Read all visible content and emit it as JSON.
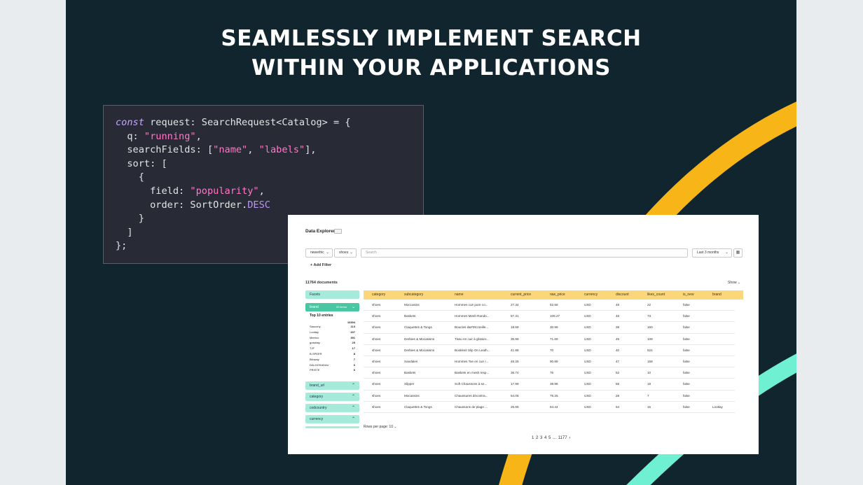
{
  "slide": {
    "headline_line1": "SEAMLESSLY IMPLEMENT SEARCH",
    "headline_line2": "WITHIN YOUR APPLICATIONS",
    "colors": {
      "background": "#10252d",
      "yellow": "#f7b518",
      "mint": "#6ff0d2",
      "page": "#e9ecef"
    }
  },
  "code": {
    "keyword_const": "const",
    "line1_rest": " request: SearchRequest<Catalog> = {",
    "q_key": "  q: ",
    "q_value": "\"running\"",
    "q_comma": ",",
    "fields_key": "  searchFields: [",
    "field1": "\"name\"",
    "fields_sep": ", ",
    "field2": "\"labels\"",
    "fields_end": "],",
    "sort_open": "  sort: [",
    "brace_open": "    {",
    "field_key": "      field: ",
    "field_value": "\"popularity\"",
    "field_comma": ",",
    "order_key": "      order: SortOrder.",
    "order_value": "DESC",
    "brace_close": "    }",
    "bracket_close": "  ]",
    "end": "};"
  },
  "explorer": {
    "title": "Data Explorer",
    "index_select": "newethic",
    "type_select": "shoes",
    "search_placeholder": "Search",
    "date_range": "Last 3 months",
    "add_filter": "+ Add Filter",
    "doc_count": "11764 documents",
    "show_label": "Show",
    "facets_label": "Facets",
    "brand_facet": {
      "label": "brand",
      "count_label": "20 items"
    },
    "top10_label": "Top 10 entries",
    "top10_total": "10394",
    "brands": [
      {
        "name": "Saucony",
        "count": "113"
      },
      {
        "name": "Lootlay",
        "count": "207"
      },
      {
        "name": "Merrico",
        "count": "391"
      },
      {
        "name": "gossbay",
        "count": "25"
      },
      {
        "name": "TJF",
        "count": "17"
      },
      {
        "name": "B-SPEER",
        "count": "8"
      },
      {
        "name": "Biloway",
        "count": "7"
      },
      {
        "name": "DALHOSADAU",
        "count": "6"
      },
      {
        "name": "PRISTE",
        "count": "6"
      }
    ],
    "other_facets": [
      "brand_url",
      "category",
      "codcountry",
      "currency"
    ],
    "columns": [
      "category",
      "subcategory",
      "name",
      "current_price",
      "raw_price",
      "currency",
      "discount",
      "likes_count",
      "is_new",
      "brand"
    ],
    "rows": [
      [
        "shoes",
        "Moccasins",
        "Hommes cuir pure co...",
        "27.34",
        "52.58",
        "USD",
        "48",
        "22",
        "false",
        ""
      ],
      [
        "shoes",
        "Baskets",
        "Hommes Mesh Rando...",
        "57.31",
        "106.27",
        "USD",
        "46",
        "73",
        "false",
        ""
      ],
      [
        "shoes",
        "Claquettes & Tongs",
        "Boucles d&#39;oreille...",
        "18.59",
        "30.99",
        "USD",
        "39",
        "160",
        "false",
        ""
      ],
      [
        "shoes",
        "Derbies & Mocassins",
        "Tissu en cuir à glissier...",
        "35.99",
        "71.69",
        "USD",
        "45",
        "108",
        "false",
        ""
      ],
      [
        "shoes",
        "Derbies & Mocassins",
        "Bookknit Slip On Leath...",
        "41.88",
        "70",
        "USD",
        "40",
        "524",
        "false",
        ""
      ],
      [
        "shoes",
        "Sandales",
        "Hommes Toe en cuir r...",
        "48.25",
        "90.89",
        "USD",
        "47",
        "158",
        "false",
        ""
      ],
      [
        "shoes",
        "Baskets",
        "Baskets en mesh resp...",
        "36.74",
        "76",
        "USD",
        "52",
        "10",
        "false",
        ""
      ],
      [
        "shoes",
        "Slipper",
        "Soft Chaussons à se...",
        "17.99",
        "39.98",
        "USD",
        "55",
        "19",
        "false",
        ""
      ],
      [
        "shoes",
        "Mocassins",
        "Chaussures décontra...",
        "54.06",
        "75.25",
        "USD",
        "28",
        "7",
        "false",
        ""
      ],
      [
        "shoes",
        "Claquettes & Tongs",
        "Chaussons de plage ...",
        "25.65",
        "64.44",
        "USD",
        "54",
        "15",
        "false",
        "Lootlay"
      ]
    ],
    "rows_per_page": "Rows per page: 10",
    "pager": "1 2 3 4 5 ... 1177 ›"
  }
}
